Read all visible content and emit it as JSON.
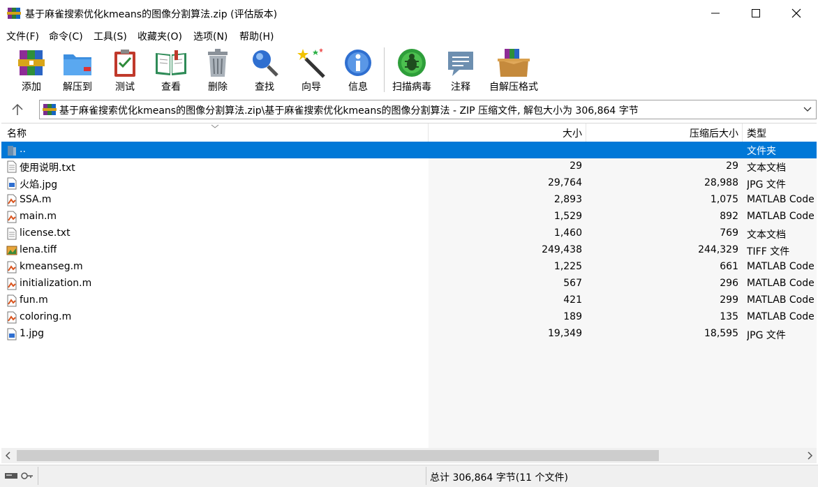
{
  "window": {
    "title": "基于麻雀搜索优化kmeans的图像分割算法.zip (评估版本)"
  },
  "menu": [
    "文件(F)",
    "命令(C)",
    "工具(S)",
    "收藏夹(O)",
    "选项(N)",
    "帮助(H)"
  ],
  "toolbar": {
    "add": "添加",
    "extract": "解压到",
    "test": "测试",
    "view": "查看",
    "delete": "删除",
    "find": "查找",
    "wizard": "向导",
    "info": "信息",
    "scan": "扫描病毒",
    "comment": "注释",
    "sfx": "自解压格式"
  },
  "address": {
    "path": "基于麻雀搜索优化kmeans的图像分割算法.zip\\基于麻雀搜索优化kmeans的图像分割算法 - ZIP 压缩文件, 解包大小为 306,864 字节"
  },
  "columns": {
    "name": "名称",
    "size": "大小",
    "packed": "压缩后大小",
    "type": "类型"
  },
  "files": [
    {
      "name": "..",
      "size": "",
      "packed": "",
      "type": "文件夹",
      "icon": "folder-up-icon"
    },
    {
      "name": "使用说明.txt",
      "size": "29",
      "packed": "29",
      "type": "文本文档",
      "icon": "text-file-icon"
    },
    {
      "name": "火焰.jpg",
      "size": "29,764",
      "packed": "28,988",
      "type": "JPG 文件",
      "icon": "image-file-icon"
    },
    {
      "name": "SSA.m",
      "size": "2,893",
      "packed": "1,075",
      "type": "MATLAB Code",
      "icon": "matlab-file-icon"
    },
    {
      "name": "main.m",
      "size": "1,529",
      "packed": "892",
      "type": "MATLAB Code",
      "icon": "matlab-file-icon"
    },
    {
      "name": "license.txt",
      "size": "1,460",
      "packed": "769",
      "type": "文本文档",
      "icon": "text-file-icon"
    },
    {
      "name": "lena.tiff",
      "size": "249,438",
      "packed": "244,329",
      "type": "TIFF 文件",
      "icon": "tiff-file-icon"
    },
    {
      "name": "kmeanseg.m",
      "size": "1,225",
      "packed": "661",
      "type": "MATLAB Code",
      "icon": "matlab-file-icon"
    },
    {
      "name": "initialization.m",
      "size": "567",
      "packed": "296",
      "type": "MATLAB Code",
      "icon": "matlab-file-icon"
    },
    {
      "name": "fun.m",
      "size": "421",
      "packed": "299",
      "type": "MATLAB Code",
      "icon": "matlab-file-icon"
    },
    {
      "name": "coloring.m",
      "size": "189",
      "packed": "135",
      "type": "MATLAB Code",
      "icon": "matlab-file-icon"
    },
    {
      "name": "1.jpg",
      "size": "19,349",
      "packed": "18,595",
      "type": "JPG 文件",
      "icon": "image-file-icon"
    }
  ],
  "status": {
    "summary": "总计 306,864 字节(11 个文件)"
  },
  "colors": {
    "selection": "#0078d7"
  }
}
